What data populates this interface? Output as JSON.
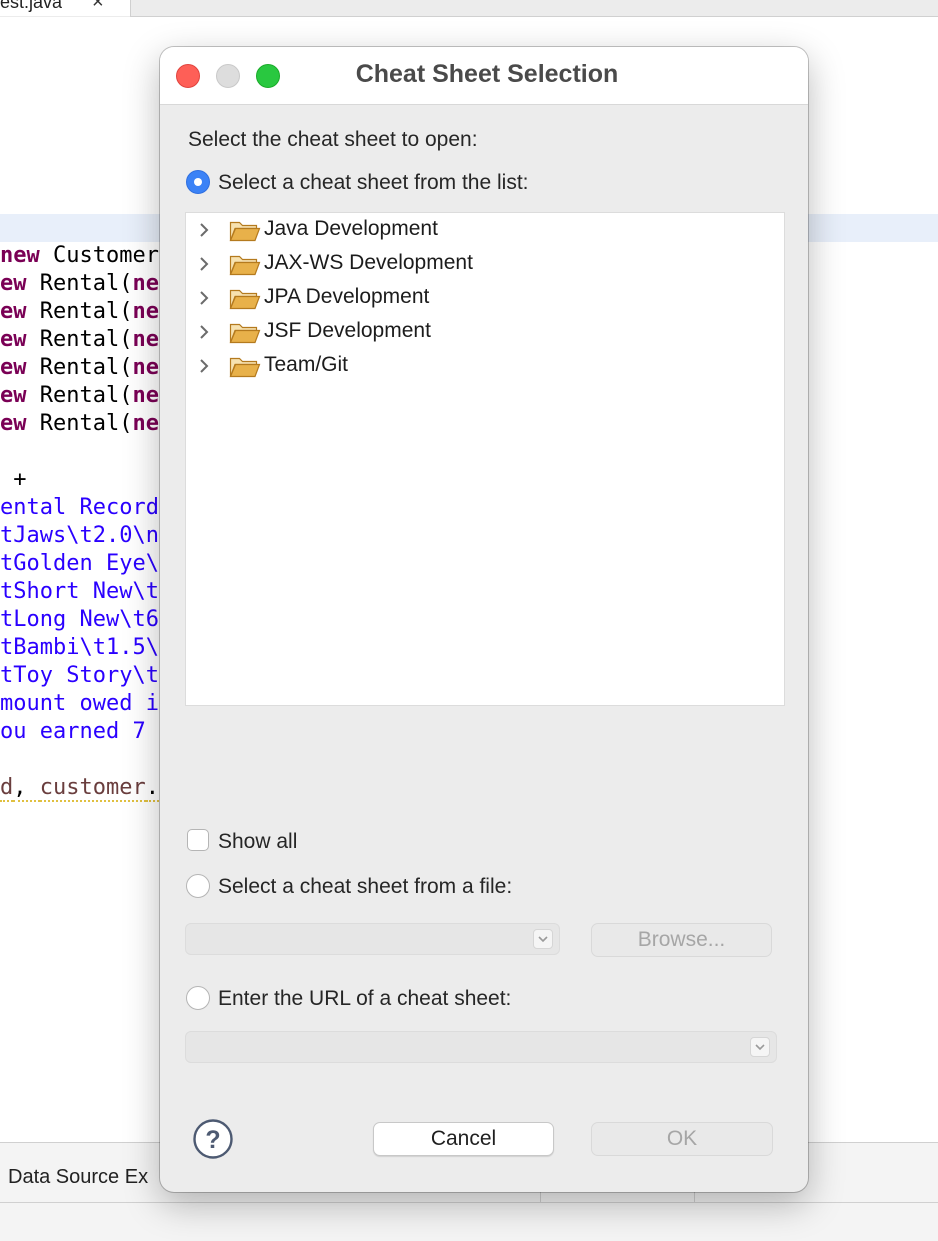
{
  "editor": {
    "tab_name": "est.java",
    "close_glyph": "×",
    "code_lines": [
      [
        {
          "t": "new",
          "c": "kw"
        },
        {
          "t": " Customer",
          "c": ""
        }
      ],
      [
        {
          "t": "ew",
          "c": "kw"
        },
        {
          "t": " Rental(",
          "c": ""
        },
        {
          "t": "ne",
          "c": "kw"
        }
      ],
      [
        {
          "t": "ew",
          "c": "kw"
        },
        {
          "t": " Rental(",
          "c": ""
        },
        {
          "t": "ne",
          "c": "kw"
        }
      ],
      [
        {
          "t": "ew",
          "c": "kw"
        },
        {
          "t": " Rental(",
          "c": ""
        },
        {
          "t": "ne",
          "c": "kw"
        }
      ],
      [
        {
          "t": "ew",
          "c": "kw"
        },
        {
          "t": " Rental(",
          "c": ""
        },
        {
          "t": "ne",
          "c": "kw"
        }
      ],
      [
        {
          "t": "ew",
          "c": "kw"
        },
        {
          "t": " Rental(",
          "c": ""
        },
        {
          "t": "ne",
          "c": "kw"
        }
      ],
      [
        {
          "t": "ew",
          "c": "kw"
        },
        {
          "t": " Rental(",
          "c": ""
        },
        {
          "t": "ne",
          "c": "kw"
        }
      ],
      [
        {
          "t": "",
          "c": ""
        }
      ],
      [
        {
          "t": " +",
          "c": ""
        }
      ],
      [
        {
          "t": "ental Record",
          "c": "str"
        }
      ],
      [
        {
          "t": "tJaws\\t2.0\\n",
          "c": "str"
        }
      ],
      [
        {
          "t": "tGolden Eye\\",
          "c": "str"
        }
      ],
      [
        {
          "t": "tShort New\\t",
          "c": "str"
        }
      ],
      [
        {
          "t": "tLong New\\t6",
          "c": "str"
        }
      ],
      [
        {
          "t": "tBambi\\t1.5\\",
          "c": "str"
        }
      ],
      [
        {
          "t": "tToy Story\\t",
          "c": "str"
        }
      ],
      [
        {
          "t": "mount owed i",
          "c": "str"
        }
      ],
      [
        {
          "t": "ou earned 7 ",
          "c": "str"
        }
      ],
      [
        {
          "t": "",
          "c": ""
        }
      ],
      [
        {
          "t": "d",
          "c": "var ul"
        },
        {
          "t": ", ",
          "c": "ul"
        },
        {
          "t": "customer",
          "c": "var ul"
        },
        {
          "t": ".",
          "c": "ul"
        }
      ]
    ],
    "stray_char": ";",
    "bottom_tab_label": "Data Source Ex"
  },
  "dialog": {
    "title": "Cheat Sheet Selection",
    "prompt": "Select the cheat sheet to open:",
    "list_option_label": "Select a cheat sheet from the list:",
    "list_option_selected": true,
    "tree_items": [
      {
        "label": "Java Development"
      },
      {
        "label": "JAX-WS Development"
      },
      {
        "label": "JPA Development"
      },
      {
        "label": "JSF Development"
      },
      {
        "label": "Team/Git"
      }
    ],
    "show_all_label": "Show all",
    "show_all_checked": false,
    "file_option_label": "Select a cheat sheet from a file:",
    "file_value": "",
    "browse_label": "Browse...",
    "url_option_label": "Enter the URL of a cheat sheet:",
    "url_value": "",
    "cancel_label": "Cancel",
    "ok_label": "OK"
  },
  "colors": {
    "selected_radio": "#3b82f6",
    "close_light": "#fe5f57",
    "minimize_light": "#dddddd",
    "zoom_light": "#29c840",
    "folder": "#e8b14a",
    "keyword": "#7a0055",
    "string": "#2a00ff"
  },
  "icons": {
    "expand": "chevron-right-icon",
    "folder": "folder-icon",
    "help": "help-icon",
    "dropdown": "chevron-down-icon"
  }
}
